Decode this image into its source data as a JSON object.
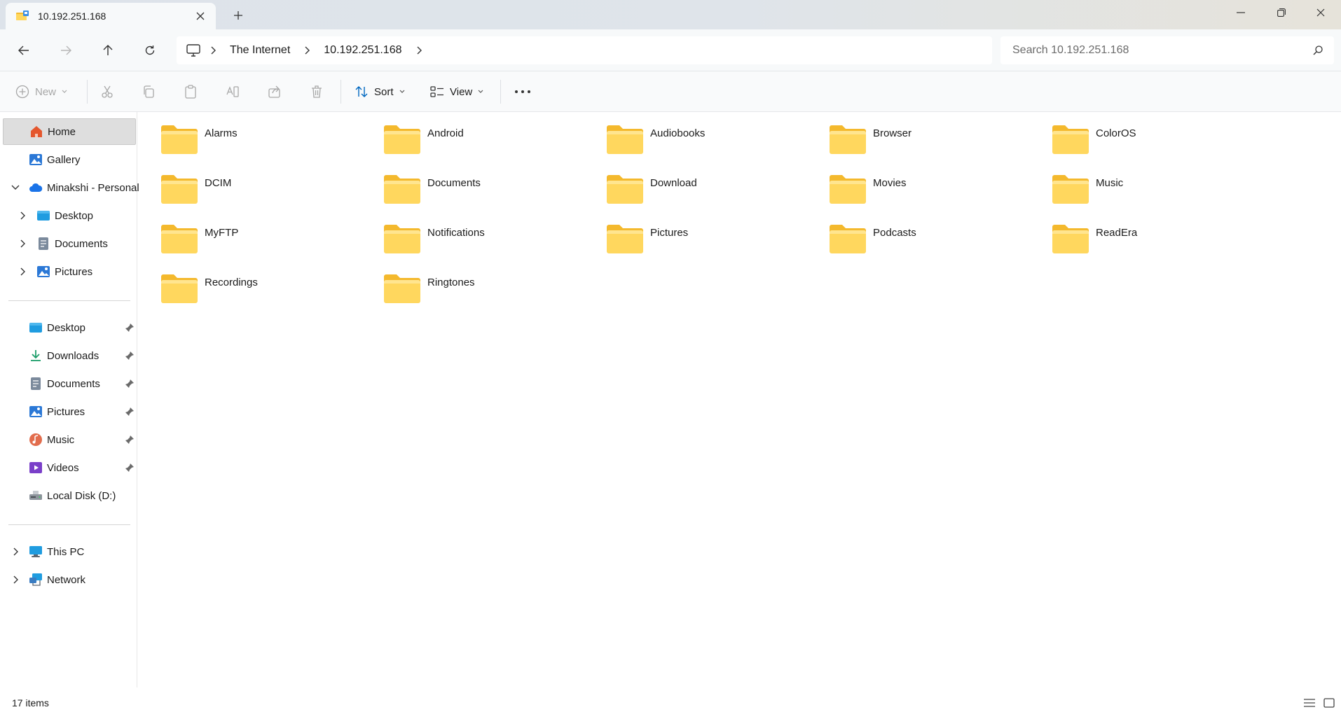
{
  "window": {
    "tab_title": "10.192.251.168",
    "new_tab_symbol": "+"
  },
  "address": {
    "crumbs": [
      "The Internet",
      "10.192.251.168"
    ],
    "search_placeholder": "Search 10.192.251.168"
  },
  "toolbar": {
    "new_label": "New",
    "sort_label": "Sort",
    "view_label": "View"
  },
  "sidebar": {
    "home": "Home",
    "gallery": "Gallery",
    "onedrive": "Minakshi - Personal",
    "onedrive_children": [
      "Desktop",
      "Documents",
      "Pictures"
    ],
    "quick_access": [
      "Desktop",
      "Downloads",
      "Documents",
      "Pictures",
      "Music",
      "Videos"
    ],
    "local_disk": "Local Disk (D:)",
    "this_pc": "This PC",
    "network": "Network"
  },
  "folders": [
    "Alarms",
    "Android",
    "Audiobooks",
    "Browser",
    "ColorOS",
    "DCIM",
    "Documents",
    "Download",
    "Movies",
    "Music",
    "MyFTP",
    "Notifications",
    "Pictures",
    "Podcasts",
    "ReadEra",
    "Recordings",
    "Ringtones"
  ],
  "status": {
    "item_count": "17 items"
  },
  "colors": {
    "accent": "#0067c0",
    "folder_front": "#ffd75e",
    "folder_back": "#f4b92d",
    "selected_bg": "#dedede"
  }
}
